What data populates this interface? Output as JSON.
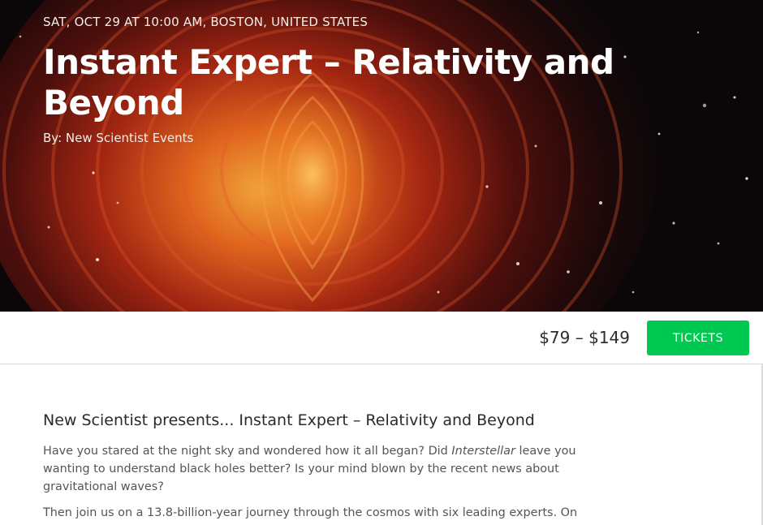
{
  "hero": {
    "meta": "SAT, OCT 29 AT 10:00 AM, BOSTON, UNITED STATES",
    "title": "Instant Expert – Relativity and Beyond",
    "organizer": "By: New Scientist Events",
    "image_description_name": "hero-image"
  },
  "ticket_bar": {
    "price": "$79 – $149",
    "button_label": "TICKETS",
    "button_color": "#00c952"
  },
  "description": {
    "heading": "New Scientist presents... Instant Expert – Relativity and Beyond",
    "para1_a": "Have you stared at the night sky and wondered how it all began? Did ",
    "para1_em": "Interstellar",
    "para1_b": " leave you",
    "para1_line2": "wanting to understand black holes better? Is your mind blown by the recent news about",
    "para1_line3": "gravitational waves?",
    "para2": "Then join us on a 13.8-billion-year journey through the cosmos with six leading experts. On"
  },
  "colors": {
    "hero_dark": "#0b0709",
    "accent_green": "#00c952",
    "text_dark": "#2a2a2a",
    "text_body": "#555555"
  }
}
